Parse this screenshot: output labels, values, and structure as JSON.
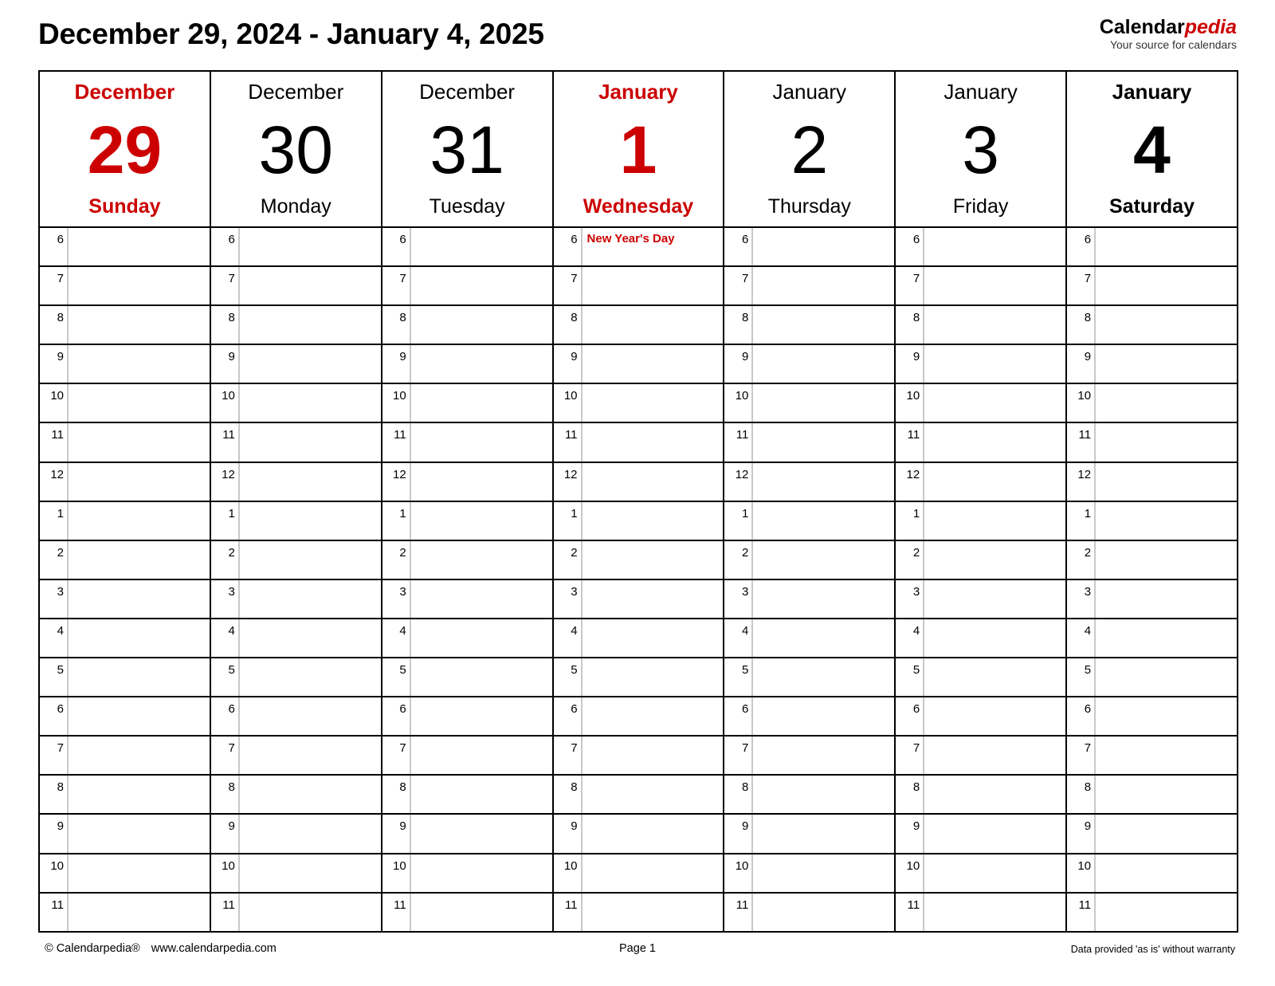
{
  "header": {
    "title": "December 29, 2024 - January 4, 2025",
    "brand_black": "Calendar",
    "brand_red": "pedia",
    "brand_tagline": "Your source for calendars"
  },
  "colors": {
    "accent_red": "#cc0000",
    "grid_black": "#000000",
    "slot_rule_gray": "#c8c8c8"
  },
  "days": [
    {
      "month": "December",
      "number": "29",
      "weekday": "Sunday",
      "style": "holiday"
    },
    {
      "month": "December",
      "number": "30",
      "weekday": "Monday",
      "style": "weekday"
    },
    {
      "month": "December",
      "number": "31",
      "weekday": "Tuesday",
      "style": "weekday"
    },
    {
      "month": "January",
      "number": "1",
      "weekday": "Wednesday",
      "style": "holiday"
    },
    {
      "month": "January",
      "number": "2",
      "weekday": "Thursday",
      "style": "weekday"
    },
    {
      "month": "January",
      "number": "3",
      "weekday": "Friday",
      "style": "weekday"
    },
    {
      "month": "January",
      "number": "4",
      "weekday": "Saturday",
      "style": "weekend"
    }
  ],
  "hours": [
    "6",
    "7",
    "8",
    "9",
    "10",
    "11",
    "12",
    "1",
    "2",
    "3",
    "4",
    "5",
    "6",
    "7",
    "8",
    "9",
    "10",
    "11"
  ],
  "events": [
    {
      "row": 0,
      "day": 3,
      "text": "New Year's Day",
      "kind": "holiday"
    }
  ],
  "footer": {
    "copyright": "© Calendarpedia®",
    "website": "www.calendarpedia.com",
    "page": "Page 1",
    "disclaimer": "Data provided 'as is' without warranty"
  }
}
